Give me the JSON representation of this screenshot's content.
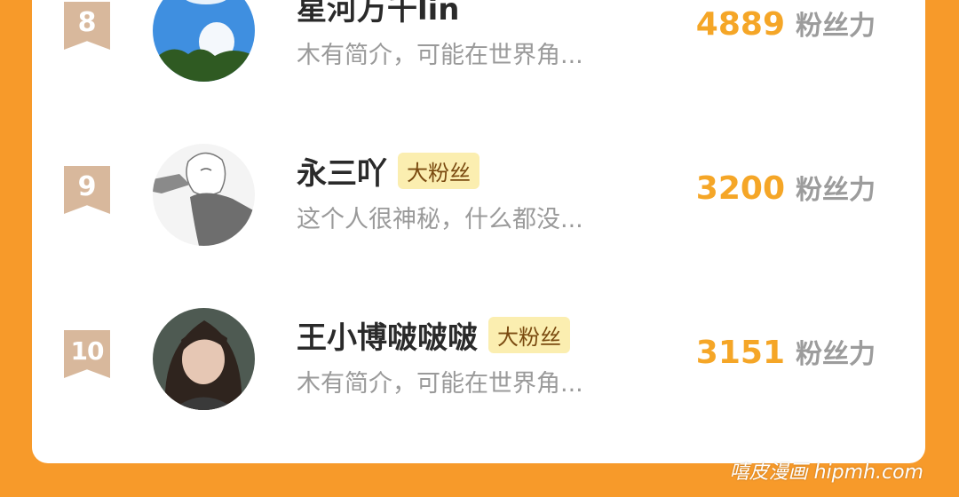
{
  "colors": {
    "background": "#f79a2a",
    "card": "#ffffff",
    "score": "#f5a627",
    "rank_badge": "#d8b89c",
    "fan_badge_bg": "#fbeeb0"
  },
  "ranking": {
    "score_unit": "粉丝力",
    "items": [
      {
        "rank": "8",
        "name": "星河万千lin",
        "badge": "",
        "bio": "木有简介，可能在世界角...",
        "score": "4889",
        "avatar": "sky-avatar-icon"
      },
      {
        "rank": "9",
        "name": "永三吖",
        "badge": "大粉丝",
        "bio": "这个人很神秘，什么都没...",
        "score": "3200",
        "avatar": "sketch-avatar-icon"
      },
      {
        "rank": "10",
        "name": "王小博啵啵啵",
        "badge": "大粉丝",
        "bio": "木有简介，可能在世界角...",
        "score": "3151",
        "avatar": "girl-avatar-icon"
      }
    ]
  },
  "watermark": "嘻皮漫画 hipmh.com"
}
